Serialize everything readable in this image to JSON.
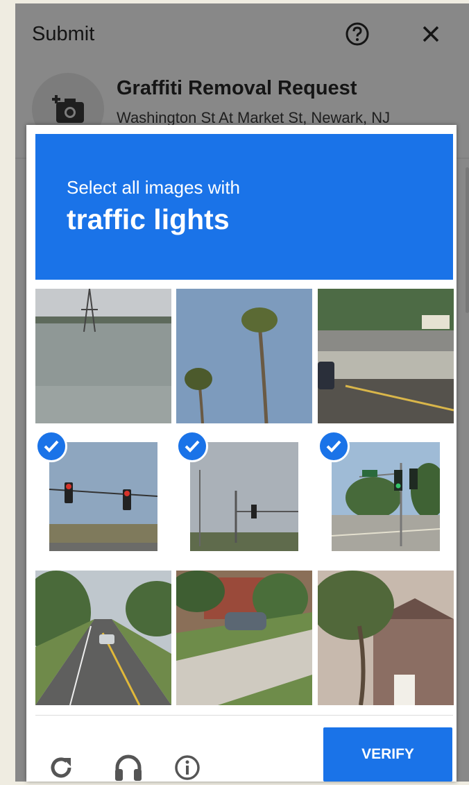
{
  "app": {
    "title": "Submit",
    "help_icon": "help-circle-icon",
    "close_icon": "close-icon",
    "request": {
      "icon": "add-photo-icon",
      "title": "Graffiti Removal Request",
      "location": "Washington St At Market St, Newark, NJ"
    }
  },
  "captcha": {
    "instruction": "Select all images with",
    "target": "traffic lights",
    "accent_color": "#1a73e8",
    "tiles": [
      {
        "description": "river with power tower",
        "selected": false
      },
      {
        "description": "palm trees against sky",
        "selected": false
      },
      {
        "description": "highway with car and barrier",
        "selected": false
      },
      {
        "description": "traffic lights over road",
        "selected": true
      },
      {
        "description": "traffic light pole under cloudy sky",
        "selected": true
      },
      {
        "description": "intersection with traffic lights",
        "selected": true
      },
      {
        "description": "tree-lined road with cars",
        "selected": false
      },
      {
        "description": "driveway with parked car",
        "selected": false
      },
      {
        "description": "palm tree near brick house",
        "selected": false
      }
    ],
    "controls": {
      "reload_icon": "reload-icon",
      "audio_icon": "headphones-icon",
      "info_icon": "info-icon"
    },
    "verify_label": "VERIFY"
  }
}
